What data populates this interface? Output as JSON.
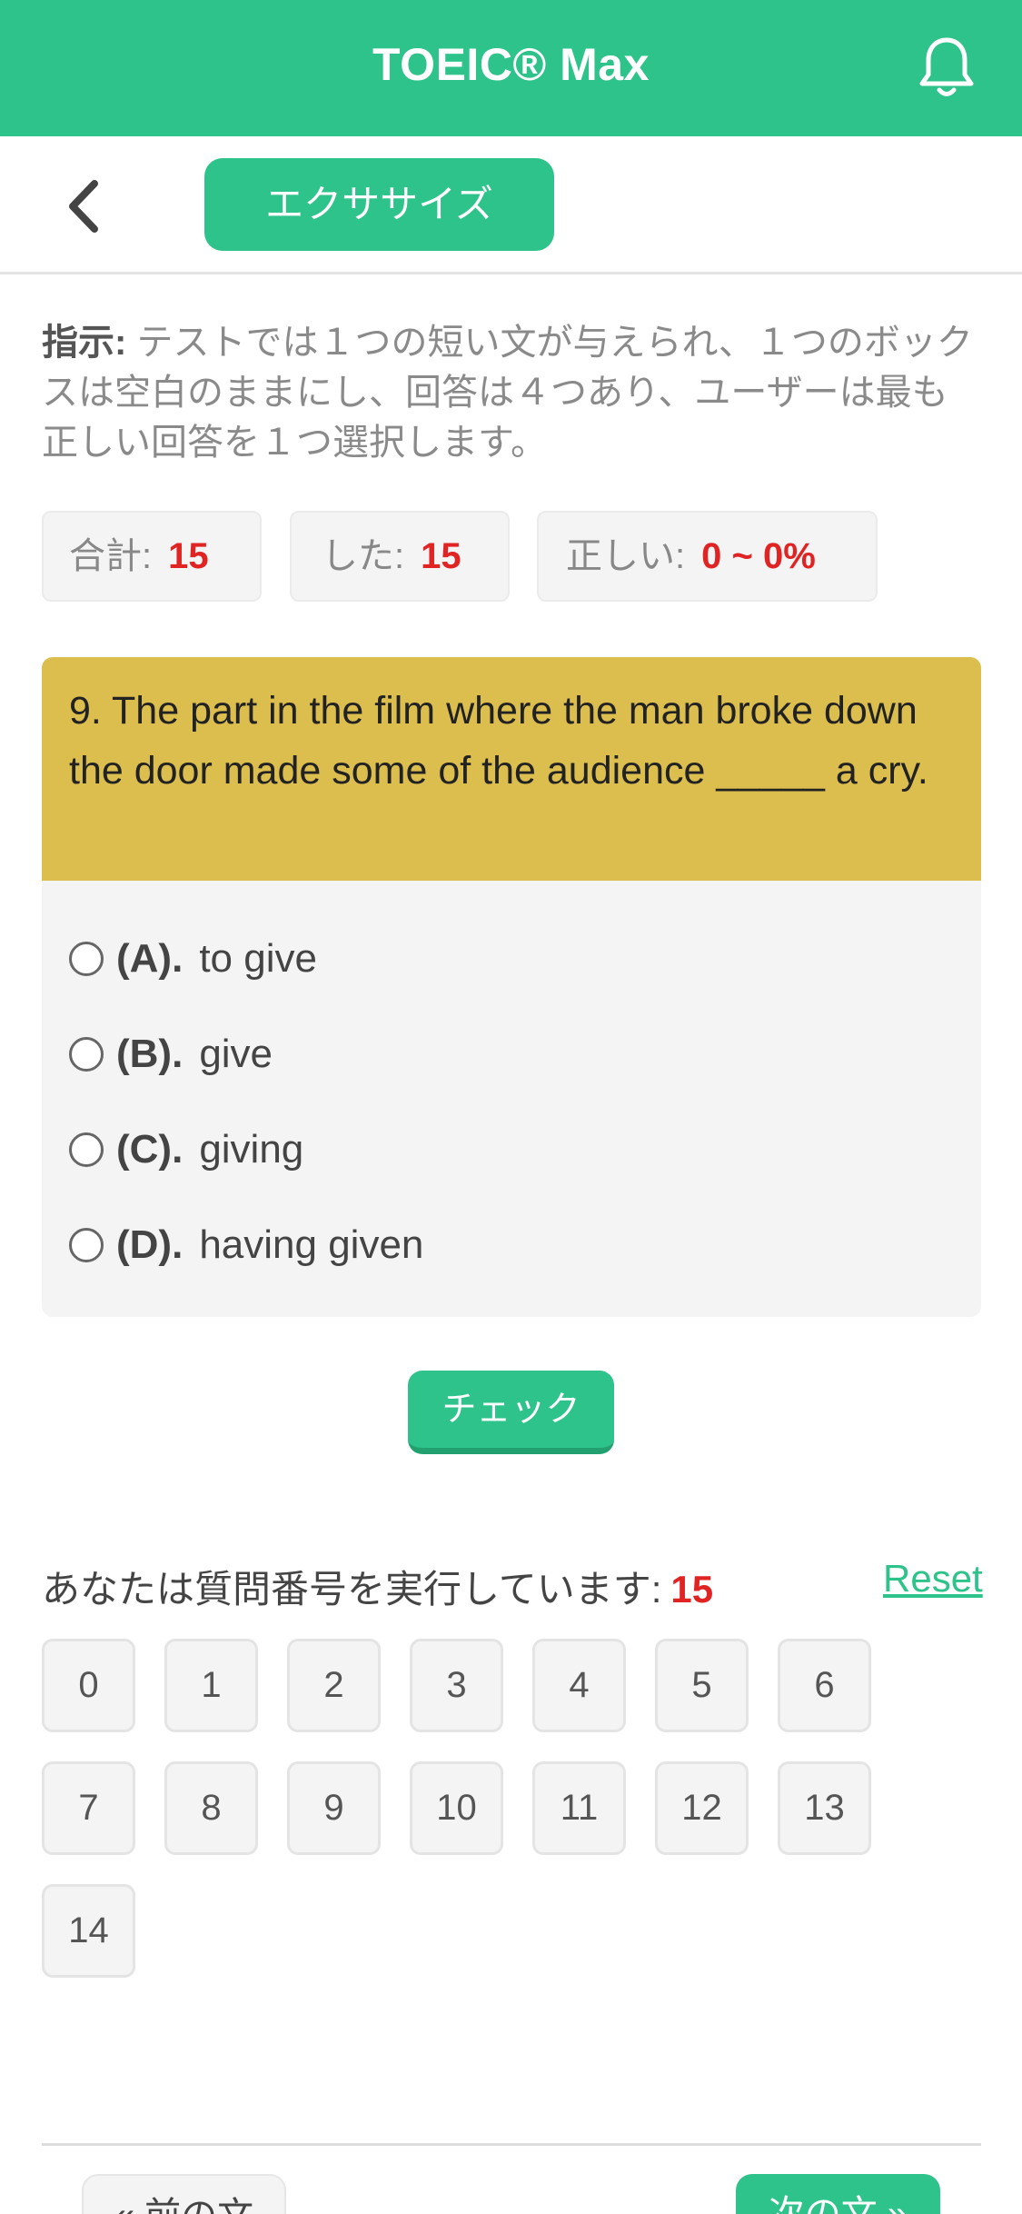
{
  "app": {
    "title": "TOEIC® Max",
    "bell_icon": "bell-icon",
    "brand_color": "#2ec38a"
  },
  "subnav": {
    "back_icon": "chevron-left-icon",
    "tab_label": "エクササイズ"
  },
  "instructions": {
    "label": "指示:",
    "text": " テストでは１つの短い文が与えられ、１つのボックスは空白のままにし、回答は４つあり、ユーザーは最も正しい回答を１つ選択します。"
  },
  "stats": {
    "total_label": "合計:",
    "total_value": "15",
    "done_label": "した:",
    "done_value": "15",
    "correct_label": "正しい:",
    "correct_value": "0 ~ 0%"
  },
  "question": {
    "text": "9. The part in the film where the man broke down the door made some of the audience _____ a cry.",
    "header_color": "#dcbe4f",
    "options": [
      {
        "label": "(A).",
        "text": "to give"
      },
      {
        "label": "(B).",
        "text": "give"
      },
      {
        "label": "(C).",
        "text": "giving"
      },
      {
        "label": "(D).",
        "text": "having given"
      }
    ]
  },
  "check_button": "チェック",
  "progress": {
    "running_label": "あなたは質問番号を実行しています:",
    "running_number": "15",
    "reset_label": "Reset",
    "numbers": [
      "0",
      "1",
      "2",
      "3",
      "4",
      "5",
      "6",
      "7",
      "8",
      "9",
      "10",
      "11",
      "12",
      "13",
      "14"
    ]
  },
  "footer": {
    "prev_label": "« 前の文",
    "next_label": "次の文 »"
  }
}
